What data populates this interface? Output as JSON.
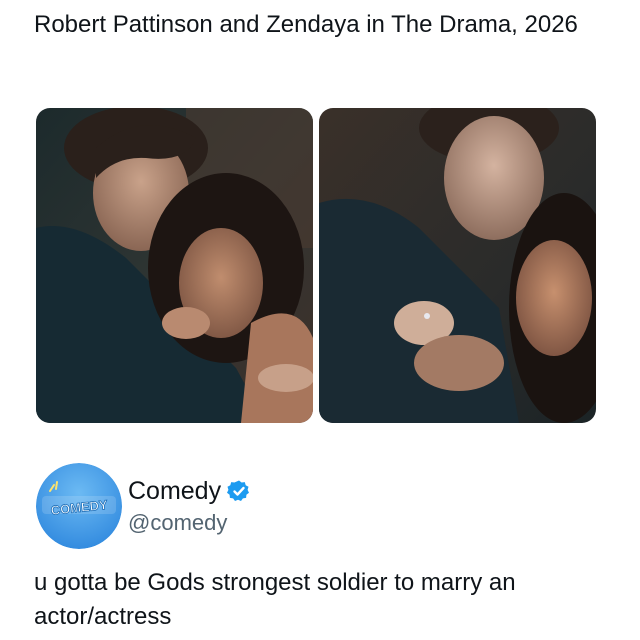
{
  "post": {
    "headline": "Robert Pattinson and Zendaya in The Drama, 2026",
    "images": [
      {
        "icon": "couple-photo-left"
      },
      {
        "icon": "couple-photo-right"
      }
    ]
  },
  "quoted_account": {
    "avatar_text": "COMEDY",
    "display_name": "Comedy",
    "handle": "@comedy",
    "verified": true,
    "text": "u gotta be Gods strongest soldier to marry an actor/actress"
  },
  "colors": {
    "text": "#0f1419",
    "secondary_text": "#536471",
    "verified_blue": "#1d9bf0",
    "avatar_blue": "#4aa3ec"
  }
}
